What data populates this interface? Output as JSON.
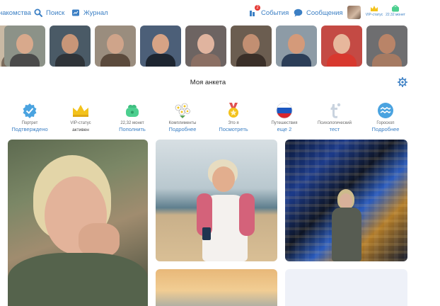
{
  "nav": {
    "dating": "накомства",
    "search": "Поиск",
    "journal": "Журнал",
    "events": "События",
    "events_badge": "2",
    "messages": "Сообщения",
    "vip_label": "VIP-статус",
    "coins_label": "22.32 монет"
  },
  "stories": [
    {
      "name": "story-1",
      "bg": "#c9b9a4",
      "skin": "#c69a7d",
      "cloth": "#7a6b5c"
    },
    {
      "name": "story-2",
      "bg": "#8c9288",
      "skin": "#d8a98c",
      "cloth": "#4a4a4a"
    },
    {
      "name": "story-3",
      "bg": "#4a5a66",
      "skin": "#c89678",
      "cloth": "#2e3338"
    },
    {
      "name": "story-4",
      "bg": "#9a8d7e",
      "skin": "#cfa48a",
      "cloth": "#5b4a3c"
    },
    {
      "name": "story-5",
      "bg": "#4c5f78",
      "skin": "#d7a385",
      "cloth": "#1d2530"
    },
    {
      "name": "story-6",
      "bg": "#6d6462",
      "skin": "#e0b49f",
      "cloth": "#8b6f63"
    },
    {
      "name": "story-7",
      "bg": "#6b5d50",
      "skin": "#c28f72",
      "cloth": "#3a2f28"
    },
    {
      "name": "story-8",
      "bg": "#8d9ba6",
      "skin": "#d49a7a",
      "cloth": "#2c3e58"
    },
    {
      "name": "story-9",
      "bg": "#c44a44",
      "skin": "#e7b79c",
      "cloth": "#d8382e"
    },
    {
      "name": "story-10",
      "bg": "#6e6e70",
      "skin": "#b98468",
      "cloth": "#a57a62"
    }
  ],
  "profile": {
    "title": "Моя анкета"
  },
  "info": [
    {
      "name": "portrait",
      "line1": "Портрет",
      "line2": "Подтверждено"
    },
    {
      "name": "vip",
      "line1": "VIP-статус",
      "line2": "активен"
    },
    {
      "name": "coins",
      "line1": "22,32 монет",
      "line2": "Пополнить"
    },
    {
      "name": "compliments",
      "line1": "Комплименты",
      "line2": "Подробнее"
    },
    {
      "name": "this-is-me",
      "line1": "Это я",
      "line2": "Посмотреть"
    },
    {
      "name": "travel",
      "line1": "Путешествия",
      "line2": "еще 2"
    },
    {
      "name": "psych-test",
      "line1": "Психологический",
      "line2": "тест"
    },
    {
      "name": "horoscope",
      "line1": "Гороскоп",
      "line2": "Подробнее"
    }
  ],
  "colors": {
    "link": "#3b7fc4",
    "accent_icon": "#4aa3e0",
    "crown": "#f3c21b",
    "wallet": "#4ccf8f"
  }
}
